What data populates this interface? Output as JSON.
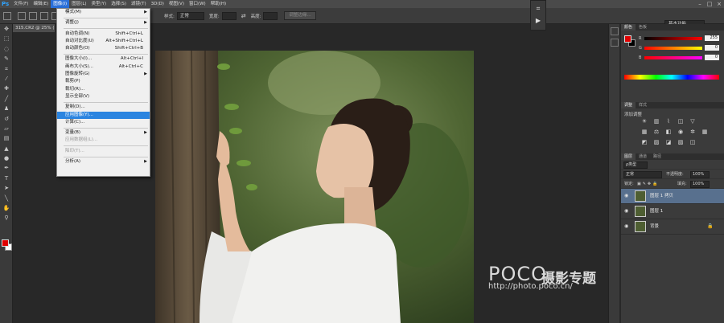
{
  "app": {
    "logo": "Ps"
  },
  "menubar": {
    "items": [
      "文件(F)",
      "编辑(E)",
      "图像(I)",
      "图层(L)",
      "类型(Y)",
      "选择(S)",
      "滤镜(T)",
      "3D(D)",
      "视图(V)",
      "窗口(W)",
      "帮助(H)"
    ],
    "active_index": 2
  },
  "window_controls": [
    "–",
    "□",
    "×"
  ],
  "options": {
    "mode_label": "样式:",
    "mode_value": "正常",
    "width_label": "宽度:",
    "height_label": "高度:",
    "refine_edge": "调整边缘...",
    "workspace": "基本功能"
  },
  "document_tab": "315.CR2 @ 25% (图",
  "image_menu": {
    "items": [
      {
        "label": "模式(M)",
        "shortcut": "",
        "submenu": true,
        "disabled": false,
        "highlight": false
      },
      {
        "sep": true
      },
      {
        "label": "调整(J)",
        "shortcut": "",
        "submenu": true,
        "disabled": false,
        "highlight": false
      },
      {
        "sep": true
      },
      {
        "label": "自动色调(N)",
        "shortcut": "Shift+Ctrl+L",
        "submenu": false,
        "disabled": false,
        "highlight": false
      },
      {
        "label": "自动对比度(U)",
        "shortcut": "Alt+Shift+Ctrl+L",
        "submenu": false,
        "disabled": false,
        "highlight": false
      },
      {
        "label": "自动颜色(O)",
        "shortcut": "Shift+Ctrl+B",
        "submenu": false,
        "disabled": false,
        "highlight": false
      },
      {
        "sep": true
      },
      {
        "label": "图像大小(I)...",
        "shortcut": "Alt+Ctrl+I",
        "submenu": false,
        "disabled": false,
        "highlight": false
      },
      {
        "label": "画布大小(S)...",
        "shortcut": "Alt+Ctrl+C",
        "submenu": false,
        "disabled": false,
        "highlight": false
      },
      {
        "label": "图像旋转(G)",
        "shortcut": "",
        "submenu": true,
        "disabled": false,
        "highlight": false
      },
      {
        "label": "裁剪(P)",
        "shortcut": "",
        "submenu": false,
        "disabled": false,
        "highlight": false
      },
      {
        "label": "裁切(R)...",
        "shortcut": "",
        "submenu": false,
        "disabled": false,
        "highlight": false
      },
      {
        "label": "显示全部(V)",
        "shortcut": "",
        "submenu": false,
        "disabled": false,
        "highlight": false
      },
      {
        "sep": true
      },
      {
        "label": "复制(D)...",
        "shortcut": "",
        "submenu": false,
        "disabled": false,
        "highlight": false
      },
      {
        "label": "应用图像(Y)...",
        "shortcut": "",
        "submenu": false,
        "disabled": false,
        "highlight": true
      },
      {
        "label": "计算(C)...",
        "shortcut": "",
        "submenu": false,
        "disabled": false,
        "highlight": false
      },
      {
        "sep": true
      },
      {
        "label": "变量(B)",
        "shortcut": "",
        "submenu": true,
        "disabled": false,
        "highlight": false
      },
      {
        "label": "应用数据组(L)...",
        "shortcut": "",
        "submenu": false,
        "disabled": true,
        "highlight": false
      },
      {
        "sep": true
      },
      {
        "label": "陷印(T)...",
        "shortcut": "",
        "submenu": false,
        "disabled": true,
        "highlight": false
      },
      {
        "sep": true
      },
      {
        "label": "分析(A)",
        "shortcut": "",
        "submenu": true,
        "disabled": false,
        "highlight": false
      }
    ]
  },
  "color_panel": {
    "tabs": [
      "颜色",
      "色板"
    ],
    "channels": [
      {
        "label": "R",
        "value": "255"
      },
      {
        "label": "G",
        "value": "0"
      },
      {
        "label": "B",
        "value": "0"
      }
    ]
  },
  "adjust_panel": {
    "tabs": [
      "调整",
      "样式"
    ],
    "title": "添加调整"
  },
  "layers_panel": {
    "tabs": [
      "图层",
      "通道",
      "路径"
    ],
    "filter": "ρ类型",
    "blend_mode": "正常",
    "opacity_label": "不透明度:",
    "opacity_value": "100%",
    "lock_label": "锁定:",
    "fill_label": "填充:",
    "fill_value": "100%",
    "layers": [
      {
        "name": "图层 1 拷贝",
        "selected": true
      },
      {
        "name": "图层 1",
        "selected": false
      },
      {
        "name": "背景",
        "selected": false
      }
    ]
  },
  "watermark": {
    "logo": "POCO",
    "title": "摄影专题",
    "url": "http://photo.poco.cn/"
  },
  "colors": {
    "foreground": "#e00000",
    "background": "#ffffff",
    "menu_highlight": "#2a84e0",
    "layer_selected": "#58708e"
  }
}
